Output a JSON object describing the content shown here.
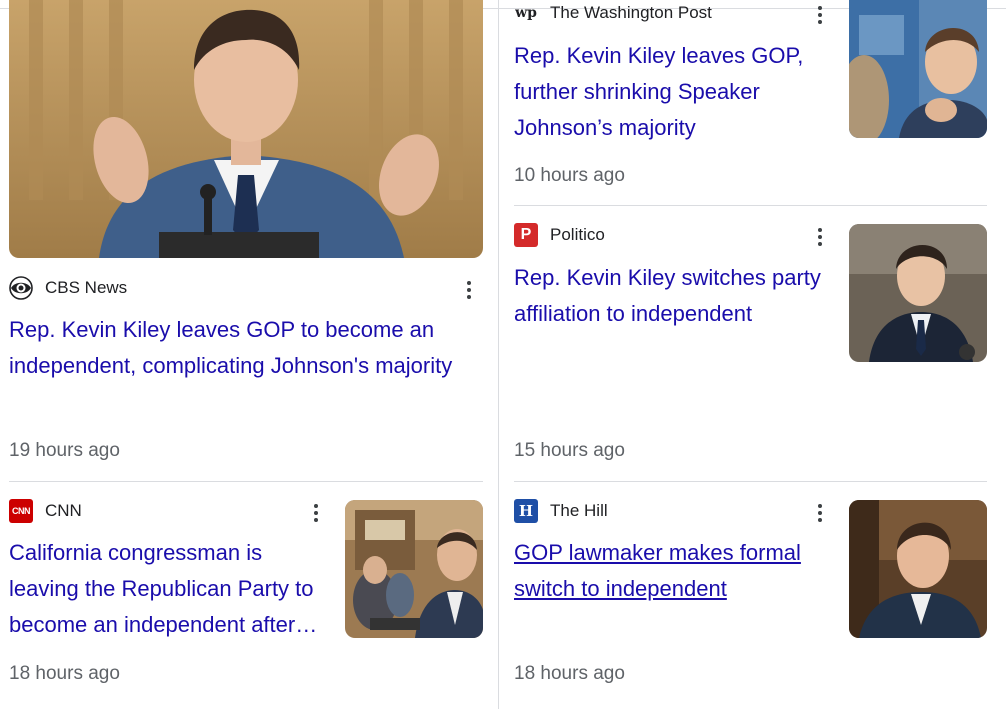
{
  "articles": [
    {
      "source": "CBS News",
      "source_icon": "cbs-eye-logo-icon",
      "headline": "Rep. Kevin Kiley leaves GOP to become an independent, complicating Johnson's majority",
      "time": "19 hours ago"
    },
    {
      "source": "The Washington Post",
      "source_icon": "washington-post-logo-icon",
      "headline": "Rep. Kevin Kiley leaves GOP, further shrinking Speaker Johnson’s majority",
      "time": "10 hours ago"
    },
    {
      "source": "Politico",
      "source_icon": "politico-logo-icon",
      "source_icon_letter": "P",
      "headline": "Rep. Kevin Kiley switches party affiliation to independent",
      "time": "15 hours ago"
    },
    {
      "source": "CNN",
      "source_icon": "cnn-logo-icon",
      "source_icon_letter": "CNN",
      "headline": "California congressman is leaving the Republican Party to become an independent after his district was redrawn",
      "time": "18 hours ago"
    },
    {
      "source": "The Hill",
      "source_icon": "the-hill-logo-icon",
      "source_icon_letter": "H",
      "headline": "GOP lawmaker makes formal switch to independent",
      "time": "18 hours ago"
    }
  ],
  "colors": {
    "headline": "#1a0dab",
    "meta": "#5f6368",
    "divider": "#dadce0",
    "politico": "#d42a2a",
    "cnn": "#cc0000",
    "the_hill": "#1f4fa6"
  }
}
